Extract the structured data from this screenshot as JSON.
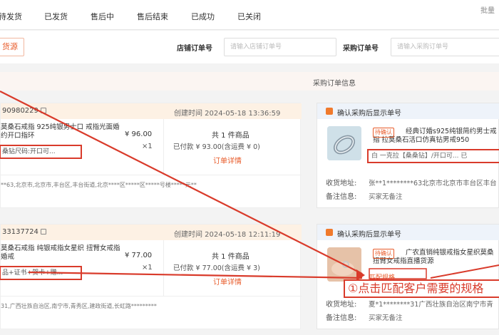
{
  "tabs": [
    "待发货",
    "已发货",
    "售后中",
    "售后结束",
    "已成功",
    "已关闭"
  ],
  "tab_link": "批量",
  "filter": {
    "source_button": "货源",
    "store_order_label": "店铺订单号",
    "store_order_placeholder": "请输入店铺订单号",
    "purchase_order_label": "采购订单号",
    "purchase_order_placeholder": "请输入采购订单号"
  },
  "column_header": "采购订单信息",
  "orders": [
    {
      "order_id": "90980229",
      "created": "创建时间 2024-05-18 13:36:59",
      "product_name": "莫桑石戒指 925纯银男士口 戒指光面婚约开口指环",
      "spec": "桑钻尺码:开口可...",
      "price": "¥ 96.00",
      "qty": "×1",
      "count": "共 1 件商品",
      "paid": "已付款 ¥ 93.00(含运费 ¥ 0)",
      "detail": "订单详情",
      "address": "**63,北京市,北京市,丰台区,丰台街道,北京****区*****区*****号楼*****元**"
    },
    {
      "order_id": "33137724",
      "created": "创建时间 2024-05-18 12:11:19",
      "product_name": "莫桑石戒指 纯银戒指女星织 扭臂女戒指婚戒",
      "spec": "品+证书+贺卡+赠...",
      "price": "¥ 77.00",
      "qty": "×1",
      "count": "共 1 件商品",
      "paid": "已付款 ¥ 77.00(含运费 ¥ 3)",
      "detail": "订单详情",
      "address": "31,广西壮族自治区,南宁市,青秀区,建政街道,长虹路*********"
    }
  ],
  "purchases": [
    {
      "header": "确认采购后显示单号",
      "badge": "待确认",
      "title": "经典订婚s925纯银简约男士戒指 拉莫桑石活口仿真钻男戒950",
      "spec": "白 一克拉【桑桑钻】/开口可... 已",
      "address_label": "收货地址:",
      "address_value": "张**1********63北京市北京市丰台区丰台",
      "remark_label": "备注信息:",
      "remark_value": "买家无备注"
    },
    {
      "header": "确认采购后显示单号",
      "badge": "待确认",
      "title": "广农直销纯银戒指女星织莫桑 扭臂女戒指直播货源",
      "spec": "",
      "address_label": "收货地址:",
      "address_value": "夏*1********31广西壮族自治区南宁市青",
      "remark_label": "备注信息:",
      "remark_value": "买家无备注"
    }
  ],
  "match_spec_link": "匹配规格",
  "callout": "①点击匹配客户需要的规格",
  "colors": {
    "accent": "#e85b2a",
    "annotation": "#d93b2b"
  }
}
